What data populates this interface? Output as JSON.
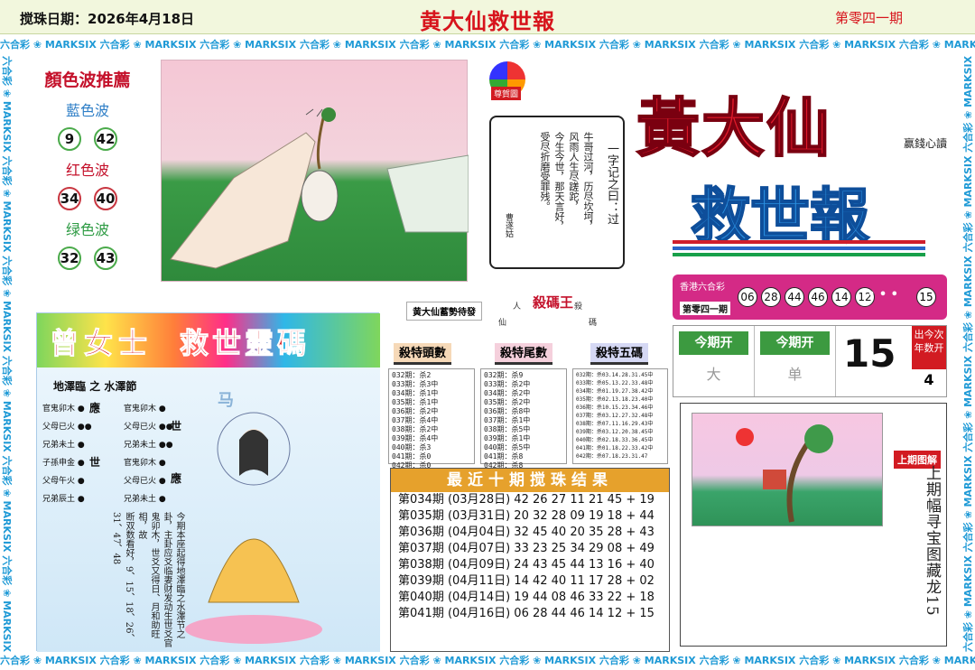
{
  "header": {
    "date": "搅珠日期：2026年4月18日",
    "title": "黄大仙救世報",
    "issue": "第零四一期"
  },
  "border": {
    "repeat_text": "六合彩 ❀ MARKSIX 六合彩 ❀ MARKSIX 六合彩 ❀ MARKSIX 六合彩 ❀ MARKSIX 六合彩 ❀ MARKSIX 六合彩 ❀ MARKSIX 六合彩 ❀ MARKSIX 六合彩 ❀ MARKSIX 六合彩 ❀ MARKSIX 六合彩 ❀ MARKSIX"
  },
  "waves": {
    "title": "顏色波推薦",
    "blue_label": "藍色波",
    "blue": [
      "9",
      "42"
    ],
    "red_label": "红色波",
    "red": [
      "34",
      "40"
    ],
    "green_label": "绿色波",
    "green": [
      "32",
      "43"
    ],
    "colors": {
      "blue": "#2f7fc7",
      "red": "#c4102a",
      "green": "#2e9b44"
    }
  },
  "scroll": {
    "title": "一字记之曰：过",
    "lines": [
      "牛哥过河，历尽坎坷，",
      "风雨人生尽蹉跎，",
      "今生今世，那天言好，",
      "受尽折磨受罪残。"
    ],
    "author": "曹遂姑",
    "badge": "尊賀圖"
  },
  "logo": {
    "line1": "黃大仙",
    "line2": "救世報",
    "slogan": "赢錢心讀"
  },
  "hk": {
    "label": "香港六合彩",
    "issue": "第零四一期",
    "numbers": [
      "06",
      "28",
      "44",
      "46",
      "14",
      "12"
    ],
    "dots": "• • •",
    "special": "15"
  },
  "kai": {
    "head1": "今期开",
    "val1": "大",
    "head2": "今期开",
    "val2": "单",
    "big": "15",
    "side": "出今次年数开",
    "small": "4"
  },
  "prev": {
    "badge": "上期图解",
    "text": "上期幅寻宝图藏龙15"
  },
  "middle": {
    "slogan": "黄大仙蓄勢待發",
    "kill_king": "殺碼王",
    "left_small": "人",
    "left_small2": "仙",
    "right_small": "殺",
    "right_small2": "碼",
    "heads": [
      "殺特頭數",
      "殺特尾數",
      "殺特五碼"
    ],
    "tables": [
      "032期：杀2\n033期：杀3中\n034期：杀1中\n035期：杀1中\n036期：杀2中\n037期：杀4中\n038期：杀2中\n039期：杀4中\n040期：杀3\n041期：杀0\n042期：杀0",
      "032期：杀9\n033期：杀2中\n034期：杀2中\n035期：杀2中\n036期：杀8中\n037期：杀1中\n038期：杀5中\n039期：杀1中\n040期：杀5中\n041期：杀8\n042期：杀8",
      "032期：杀03.14.28.31.45中\n033期：杀05.13.22.33.48中\n034期：杀01.19.27.38.42中\n035期：杀02.13.18.23.40中\n036期：杀10.15.23.34.46中\n037期：杀03.12.27.32.48中\n038期：杀07.11.16.29.43中\n039期：杀03.12.20.38.45中\n040期：杀02.18.33.36.45中\n041期：杀01.18.22.33.42中\n042期：杀07.18.23.31.47"
    ]
  },
  "recent": {
    "title": "最近十期搅珠结果",
    "rows": [
      "第034期  (03月28日)  42 26 27 11 21 45 + 19",
      "第035期  (03月31日)  20 32 28 09 19 18 + 44",
      "第036期  (04月04日)  32 45 40 20 35 28 + 43",
      "第037期  (04月07日)  33 23 25 34 29 08 + 49",
      "第038期  (04月09日)  24 43 45 44 13 16 + 40",
      "第039期  (04月11日)  14 42 40 11 17 28 + 02",
      "第040期  (04月14日)  19 44 08 46 33 22 + 18",
      "第041期  (04月16日)  06 28 44 46 14 12 + 15"
    ]
  },
  "leftpanel": {
    "name": "曾女士",
    "title": "救世靈碼",
    "subtitle": "地澤臨 之 水澤節",
    "left_rows": [
      "官鬼卯木 ●",
      "父母已火 ●●",
      "兄弟未土 ●",
      "子孫申金 ●",
      "父母午火 ●",
      "兄弟辰土 ●"
    ],
    "right_rows": [
      "官鬼卯木 ●",
      "父母已火 ●●",
      "兄弟未土 ●●",
      "官鬼卯木 ●",
      "父母已火 ●",
      "兄弟未土 ●"
    ],
    "mark_ying1": "應",
    "mark_shi1": "世",
    "mark_shi2": "世",
    "mark_ying2": "應",
    "verse1": "今期本座起得地澤臨之水澤节之卦，主卦应爻临妻财发动生世爻官鬼卯木，世爻又得日、月和助旺相，故",
    "verse2": "断双数看好，9、15、18、26、31、47、48",
    "horse": "马"
  }
}
